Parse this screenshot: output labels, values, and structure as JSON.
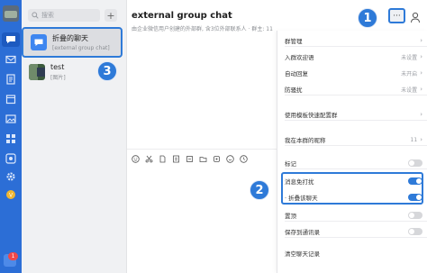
{
  "colors": {
    "rail": "#2c6ed6",
    "accent": "#2e7ad8",
    "toggle_off": "#d6d7da"
  },
  "rail": {
    "badge_count": "1"
  },
  "list": {
    "search_placeholder": "搜索",
    "add_label": "+",
    "items": [
      {
        "title": "折叠的聊天",
        "subtitle": "[external group chat]",
        "icon": "chat-bubble-icon"
      },
      {
        "title": "test",
        "subtitle": "[图片]",
        "icon": "image-avatar"
      }
    ]
  },
  "chat": {
    "title": "external group chat",
    "subtitle": "由企业微信用户创建的外部群, 含3位外部联系人 · 群主: 11",
    "toolbar_icons": [
      "emoji-icon",
      "scissors-icon",
      "file-icon",
      "doc-icon",
      "note-icon",
      "folder-icon",
      "sticker-icon",
      "smile-icon",
      "time-icon"
    ]
  },
  "header": {
    "more_label": "···"
  },
  "panel": {
    "rows": [
      {
        "label": "群管理",
        "value": "",
        "chev": "›"
      },
      {
        "label": "入群欢迎语",
        "value": "未设置",
        "chev": "›"
      },
      {
        "label": "自动回复",
        "value": "未开启",
        "chev": "›"
      },
      {
        "label": "防骚扰",
        "value": "未设置",
        "chev": "›"
      },
      {
        "label": "使用模板快速配置群",
        "value": "",
        "chev": "›"
      },
      {
        "label": "我在本群的昵称",
        "value": "11",
        "chev": "›"
      },
      {
        "label": "标记",
        "toggle": false
      },
      {
        "label": "消息免打扰",
        "toggle": true
      },
      {
        "label": "· 折叠该聊天",
        "toggle": true
      },
      {
        "label": "置顶",
        "toggle": false
      },
      {
        "label": "保存到通讯录",
        "toggle": false
      },
      {
        "label": "清空聊天记录",
        "value": "",
        "chev": ""
      }
    ]
  },
  "callouts": {
    "one": "1",
    "two": "2",
    "three": "3"
  }
}
